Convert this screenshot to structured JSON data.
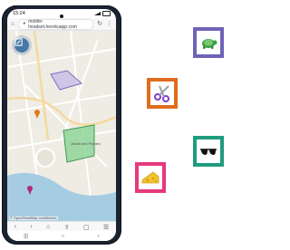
{
  "status": {
    "time": "15:24"
  },
  "browser": {
    "url": "mobile-headset.herokuapp.com"
  },
  "map": {
    "attribution": "© OpenStreetMap contributors",
    "label": "Jardin des Plantes"
  },
  "cards": [
    {
      "name": "turtle",
      "color": "#6f63b8"
    },
    {
      "name": "scissors",
      "color": "#e06c1e"
    },
    {
      "name": "sunglasses",
      "color": "#1f9c7e"
    },
    {
      "name": "cheese",
      "color": "#e6397c"
    }
  ],
  "colors": {
    "accent": "#4a78a6",
    "water": "#a6cce2",
    "park": "#7fcf8e",
    "zone": "#9b8fd8"
  }
}
